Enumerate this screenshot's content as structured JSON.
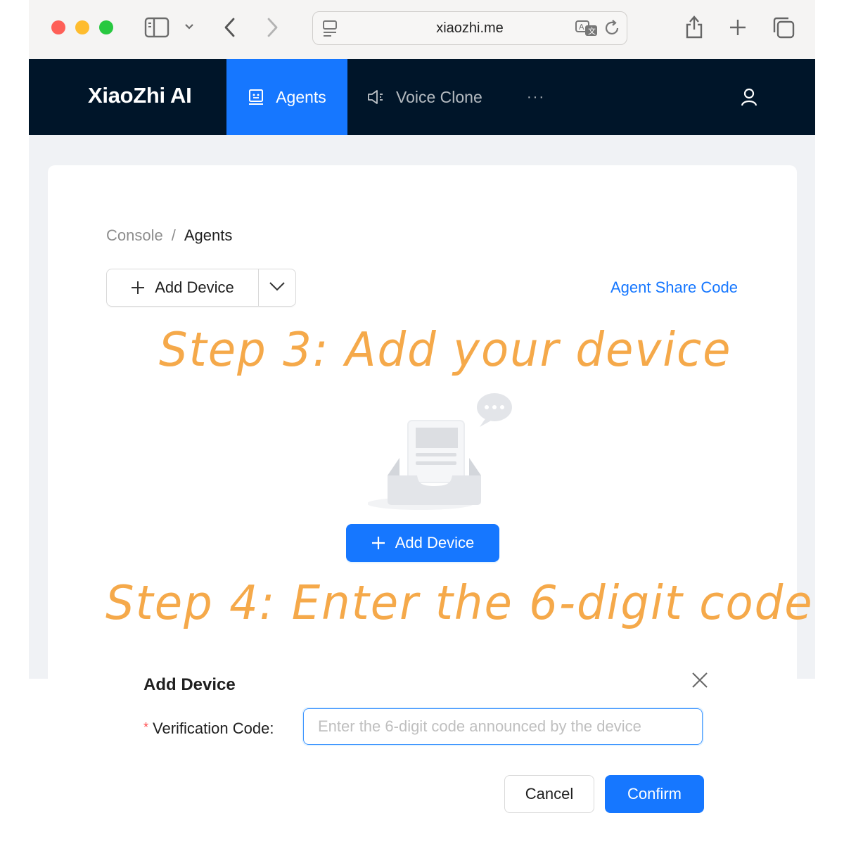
{
  "browser": {
    "url": "xiaozhi.me",
    "icons": [
      "sidebar-icon",
      "chevron-down-icon",
      "back-icon",
      "forward-icon",
      "reader-icon",
      "translate-icon",
      "reload-icon",
      "share-icon",
      "new-tab-icon",
      "tabs-overview-icon"
    ]
  },
  "nav": {
    "brand": "XiaoZhi AI",
    "tabs": [
      {
        "label": "Agents",
        "icon": "robot-icon",
        "active": true
      },
      {
        "label": "Voice Clone",
        "icon": "sound-icon",
        "active": false
      }
    ],
    "more": "···",
    "colors": {
      "background": "#001529",
      "active": "#1677ff"
    }
  },
  "breadcrumb": {
    "items": [
      "Console",
      "Agents"
    ],
    "separator": "/"
  },
  "toolbar": {
    "add_device_label": "Add Device",
    "share_code_link": "Agent Share Code"
  },
  "annotations": {
    "step3": "Step 3: Add your device",
    "step4": "Step 4: Enter the 6-digit code",
    "color": "#f5a94a"
  },
  "empty_state": {
    "add_device_label": "Add Device"
  },
  "modal": {
    "title": "Add Device",
    "field_label": "Verification Code",
    "field_colon": ":",
    "required_mark": "*",
    "placeholder": "Enter the 6-digit code announced by the device",
    "value": "",
    "cancel_label": "Cancel",
    "confirm_label": "Confirm"
  }
}
